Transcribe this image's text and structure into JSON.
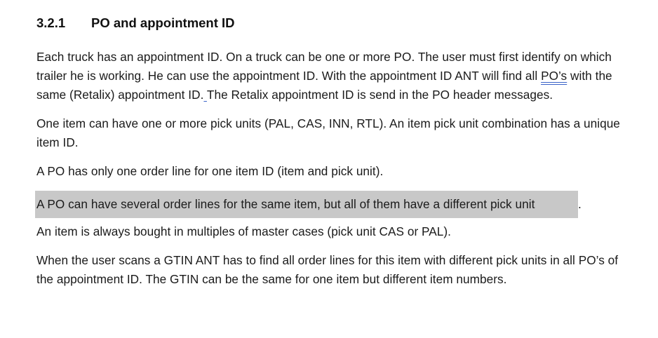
{
  "heading": {
    "number": "3.2.1",
    "title": "PO and appointment ID"
  },
  "paragraphs": {
    "p1": {
      "part1": "Each truck has an appointment ID. On a truck can be one or more PO. The user must first identify on which trailer he is working. He can use the appointment ID. With the appointment ID ANT will find all ",
      "underlined": "PO’s",
      "part2": " with the same (Retalix) appointment ID.",
      "marked_space": " ",
      "part3": "The Retalix appointment ID is send in the PO header messages."
    },
    "p2": "One item can have one or more pick units (PAL, CAS, INN, RTL). An item pick unit combination has a unique item ID.",
    "p3": "A PO has only one order line for one item ID (item and pick unit).",
    "p4": {
      "highlighted": "A PO can have several order lines for the same item, but all of them have a different pick unit",
      "tail": "."
    },
    "p5": "An item is always bought in multiples of master cases (pick unit CAS or PAL).",
    "p6": "When the user scans a GTIN ANT has to find all order lines for this item with different pick units in all PO’s of the appointment ID. The GTIN can be the same for one item but different item numbers."
  }
}
